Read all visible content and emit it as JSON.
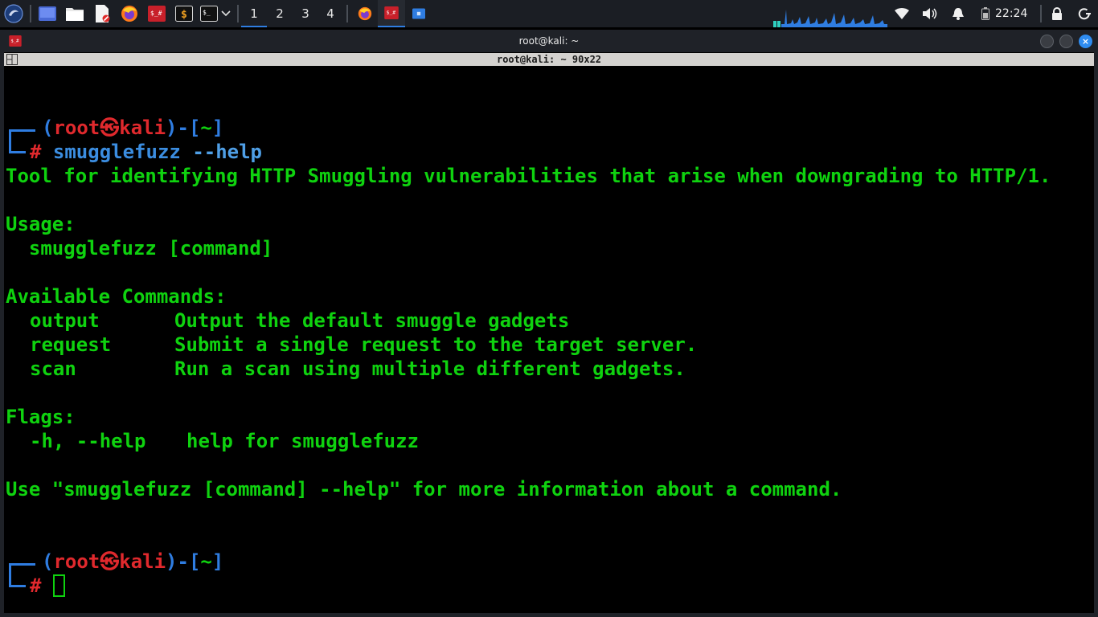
{
  "panel": {
    "workspaces": [
      "1",
      "2",
      "3",
      "4"
    ],
    "active_workspace": "1",
    "clock": "22:24"
  },
  "window": {
    "title": "root@kali: ~",
    "terminal_header": "root@kali: ~ 90x22"
  },
  "terminal": {
    "prompt": {
      "open": "(",
      "user": "root",
      "at_symbol": "㉿",
      "host": "kali",
      "close_dash": ")-[",
      "dir": "~",
      "close": "]",
      "hash": "#"
    },
    "command": {
      "name": "smugglefuzz",
      "args": "--help"
    },
    "output": {
      "description": "Tool for identifying HTTP Smuggling vulnerabilities that arise when downgrading to HTTP/1.",
      "usage_heading": "Usage:",
      "usage_line": "  smugglefuzz [command]",
      "commands_heading": "Available Commands:",
      "commands": [
        {
          "name": "output",
          "desc": "Output the default smuggle gadgets"
        },
        {
          "name": "request",
          "desc": "Submit a single request to the target server."
        },
        {
          "name": "scan",
          "desc": "Run a scan using multiple different gadgets."
        }
      ],
      "flags_heading": "Flags:",
      "flags": [
        {
          "name": "-h, --help",
          "desc": "help for smugglefuzz"
        }
      ],
      "footer": "Use \"smugglefuzz [command] --help\" for more information about a command."
    }
  },
  "colors": {
    "output_green": "#0fd20f",
    "prompt_blue": "#2f7de1",
    "prompt_red": "#e0292d",
    "panel_bg": "#1b1e24",
    "accent": "#2f7de1"
  },
  "icons": [
    "kali-menu-icon",
    "desktop-icon",
    "file-manager-icon",
    "text-editor-icon",
    "firefox-icon",
    "terminal-red-icon",
    "terminal-dollar-icon",
    "terminal-icon",
    "chevron-down-icon",
    "network-icon",
    "volume-icon",
    "bell-icon",
    "battery-icon",
    "lock-icon",
    "power-icon"
  ]
}
